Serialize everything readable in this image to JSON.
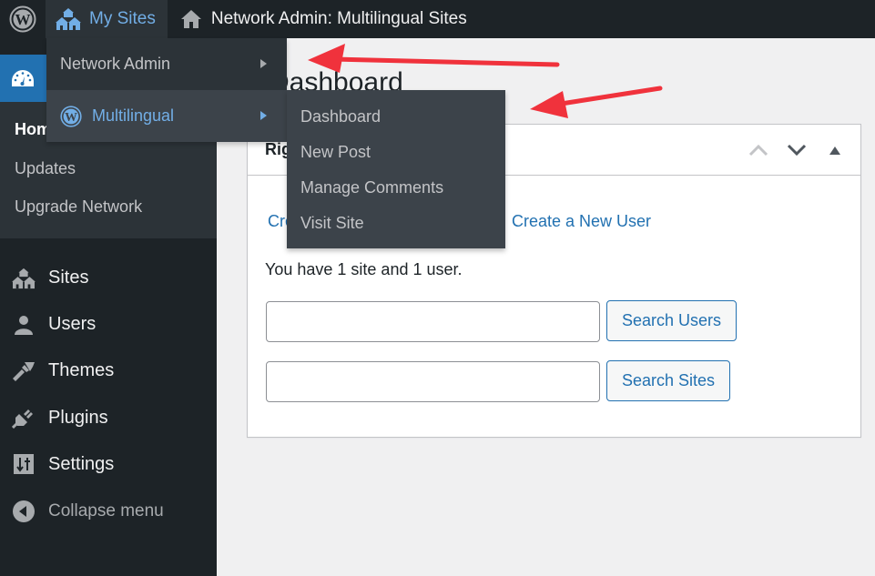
{
  "admin_bar": {
    "wp_logo_icon": "wordpress-logo-icon",
    "my_sites_label": "My Sites",
    "network_title": "Network Admin: Multilingual Sites"
  },
  "my_sites_menu": {
    "items": [
      {
        "label": "Network Admin",
        "has_submenu": true
      },
      {
        "label": "Multilingual",
        "has_submenu": true,
        "hovered": true
      }
    ],
    "submenu": [
      "Dashboard",
      "New Post",
      "Manage Comments",
      "Visit Site"
    ]
  },
  "sidebar": {
    "dashboard_sub": [
      "Home",
      "Updates",
      "Upgrade Network"
    ],
    "items": [
      {
        "label": "Sites",
        "icon": "multisite-icon"
      },
      {
        "label": "Users",
        "icon": "user-icon"
      },
      {
        "label": "Themes",
        "icon": "paintbrush-icon"
      },
      {
        "label": "Plugins",
        "icon": "plugin-icon"
      },
      {
        "label": "Settings",
        "icon": "settings-icon"
      },
      {
        "label": "Collapse menu",
        "icon": "collapse-icon"
      }
    ],
    "active_color": "#2271b1"
  },
  "main": {
    "page_title": "Dashboard",
    "widget": {
      "title": "Right Now",
      "link_create_site": "Create a New Site",
      "link_create_user": "Create a New User",
      "count_text": "You have 1 site and 1 user.",
      "search_users_value": "",
      "search_users_button": "Search Users",
      "search_sites_value": "",
      "search_sites_button": "Search Sites"
    }
  },
  "colors": {
    "admin_bar_bg": "#1d2327",
    "link_blue": "#2271b1",
    "hover_blue": "#72aee6",
    "annotation_red": "#f0323c"
  }
}
